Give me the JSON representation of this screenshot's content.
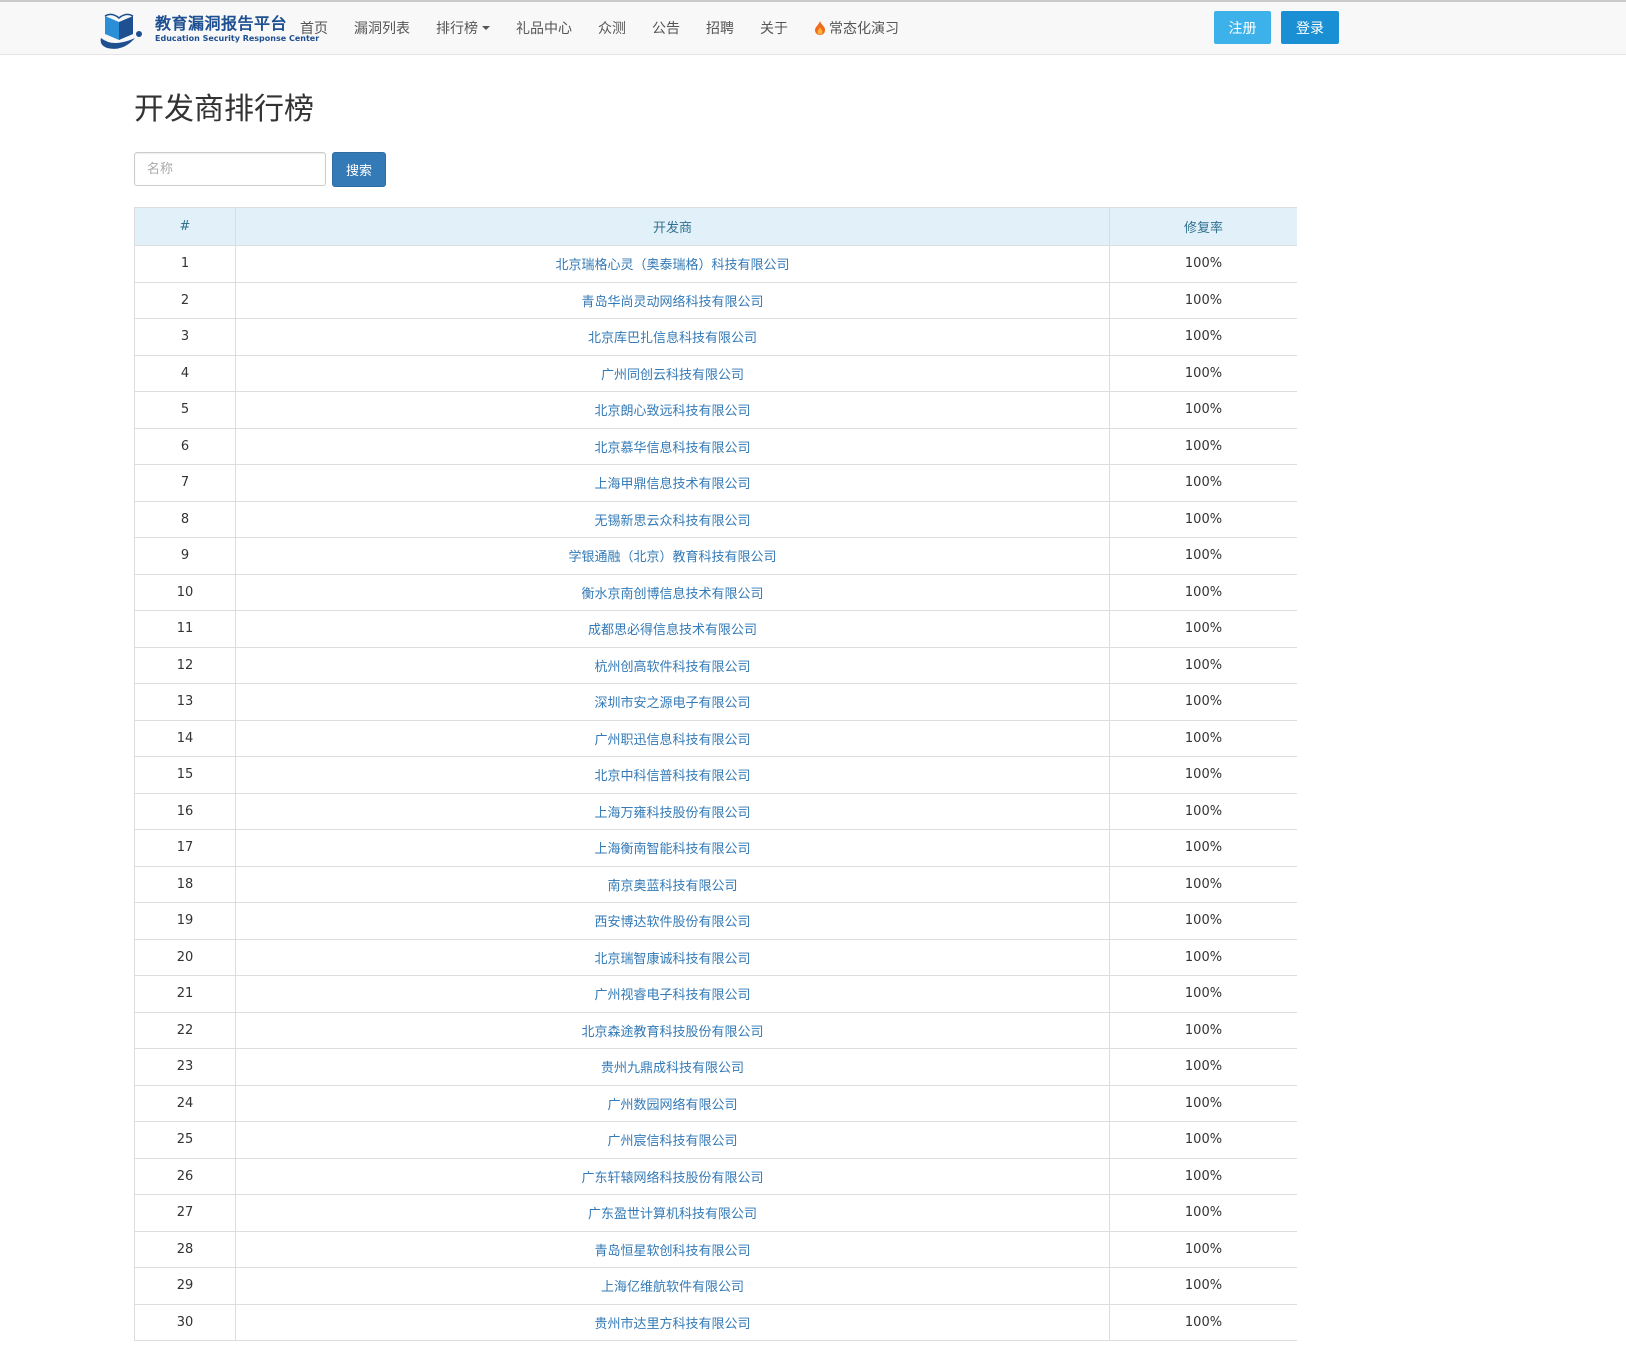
{
  "brand": {
    "title": "教育漏洞报告平台",
    "subtitle": "Education Security Response Center"
  },
  "nav": {
    "items": [
      {
        "label": "首页",
        "name": "nav-home"
      },
      {
        "label": "漏洞列表",
        "name": "nav-vuln-list"
      },
      {
        "label": "排行榜",
        "name": "nav-ranking",
        "dropdown": true
      },
      {
        "label": "礼品中心",
        "name": "nav-gifts"
      },
      {
        "label": "众测",
        "name": "nav-crowdtest"
      },
      {
        "label": "公告",
        "name": "nav-announcements"
      },
      {
        "label": "招聘",
        "name": "nav-jobs"
      },
      {
        "label": "关于",
        "name": "nav-about"
      },
      {
        "label": "常态化演习",
        "name": "nav-drill",
        "icon": "flame-icon"
      }
    ],
    "register_label": "注册",
    "login_label": "登录"
  },
  "page": {
    "title": "开发商排行榜"
  },
  "search": {
    "placeholder": "名称",
    "button_label": "搜索"
  },
  "table": {
    "headers": [
      "#",
      "开发商",
      "修复率"
    ],
    "rows": [
      {
        "rank": "1",
        "developer": "北京瑞格心灵（奥泰瑞格）科技有限公司",
        "rate": "100%"
      },
      {
        "rank": "2",
        "developer": "青岛华尚灵动网络科技有限公司",
        "rate": "100%"
      },
      {
        "rank": "3",
        "developer": "北京库巴扎信息科技有限公司",
        "rate": "100%"
      },
      {
        "rank": "4",
        "developer": "广州同创云科技有限公司",
        "rate": "100%"
      },
      {
        "rank": "5",
        "developer": "北京朗心致远科技有限公司",
        "rate": "100%"
      },
      {
        "rank": "6",
        "developer": "北京慕华信息科技有限公司",
        "rate": "100%"
      },
      {
        "rank": "7",
        "developer": "上海甲鼎信息技术有限公司",
        "rate": "100%"
      },
      {
        "rank": "8",
        "developer": "无锡新思云众科技有限公司",
        "rate": "100%"
      },
      {
        "rank": "9",
        "developer": "学银通融（北京）教育科技有限公司",
        "rate": "100%"
      },
      {
        "rank": "10",
        "developer": "衡水京南创博信息技术有限公司",
        "rate": "100%"
      },
      {
        "rank": "11",
        "developer": "成都思必得信息技术有限公司",
        "rate": "100%"
      },
      {
        "rank": "12",
        "developer": "杭州创高软件科技有限公司",
        "rate": "100%"
      },
      {
        "rank": "13",
        "developer": "深圳市安之源电子有限公司",
        "rate": "100%"
      },
      {
        "rank": "14",
        "developer": "广州职迅信息科技有限公司",
        "rate": "100%"
      },
      {
        "rank": "15",
        "developer": "北京中科信普科技有限公司",
        "rate": "100%"
      },
      {
        "rank": "16",
        "developer": "上海万雍科技股份有限公司",
        "rate": "100%"
      },
      {
        "rank": "17",
        "developer": "上海衡南智能科技有限公司",
        "rate": "100%"
      },
      {
        "rank": "18",
        "developer": "南京奥蓝科技有限公司",
        "rate": "100%"
      },
      {
        "rank": "19",
        "developer": "西安博达软件股份有限公司",
        "rate": "100%"
      },
      {
        "rank": "20",
        "developer": "北京瑞智康诚科技有限公司",
        "rate": "100%"
      },
      {
        "rank": "21",
        "developer": "广州视睿电子科技有限公司",
        "rate": "100%"
      },
      {
        "rank": "22",
        "developer": "北京森途教育科技股份有限公司",
        "rate": "100%"
      },
      {
        "rank": "23",
        "developer": "贵州九鼎成科技有限公司",
        "rate": "100%"
      },
      {
        "rank": "24",
        "developer": "广州数园网络有限公司",
        "rate": "100%"
      },
      {
        "rank": "25",
        "developer": "广州宸信科技有限公司",
        "rate": "100%"
      },
      {
        "rank": "26",
        "developer": "广东轩辕网络科技股份有限公司",
        "rate": "100%"
      },
      {
        "rank": "27",
        "developer": "广东盈世计算机科技有限公司",
        "rate": "100%"
      },
      {
        "rank": "28",
        "developer": "青岛恒星软创科技有限公司",
        "rate": "100%"
      },
      {
        "rank": "29",
        "developer": "上海亿维航软件有限公司",
        "rate": "100%"
      },
      {
        "rank": "30",
        "developer": "贵州市达里方科技有限公司",
        "rate": "100%"
      }
    ]
  },
  "colors": {
    "link": "#337ab7",
    "header_bg": "#e2f1f9",
    "header_text": "#31708f",
    "register_bg": "#3db2ea",
    "login_bg": "#1a8fd3",
    "search_btn_bg": "#337ab7"
  }
}
